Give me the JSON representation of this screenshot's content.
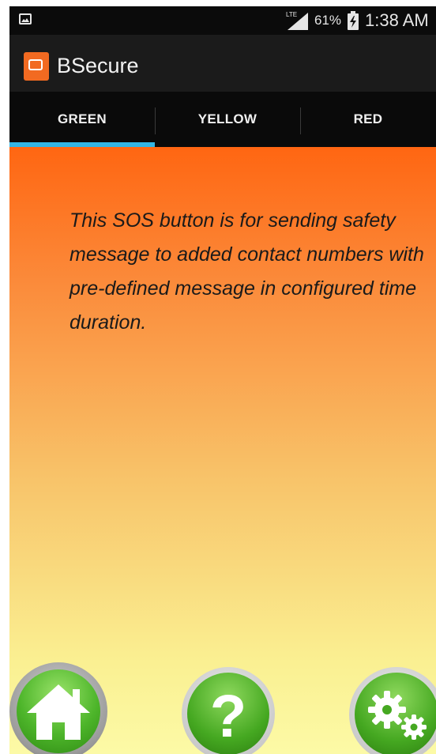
{
  "status_bar": {
    "network_type": "LTE",
    "battery_percent": "61%",
    "time": "1:38 AM",
    "icons": [
      "gallery-icon",
      "signal-icon",
      "battery-charging-icon"
    ]
  },
  "app": {
    "title": "BSecure",
    "brand_color": "#f26a21"
  },
  "tabs": [
    {
      "label": "GREEN",
      "selected": true
    },
    {
      "label": "YELLOW",
      "selected": false
    },
    {
      "label": "RED",
      "selected": false
    }
  ],
  "tab_indicator_color": "#33b5e5",
  "content": {
    "info_text": "This SOS button is for sending safety message to added contact numbers with pre-defined message in configured time duration.",
    "gradient_top": "#ff6612",
    "gradient_bottom": "#fcfaa6"
  },
  "bottom_buttons": [
    {
      "icon": "home-icon"
    },
    {
      "icon": "help-icon",
      "glyph": "?"
    },
    {
      "icon": "settings-gears-icon"
    }
  ]
}
